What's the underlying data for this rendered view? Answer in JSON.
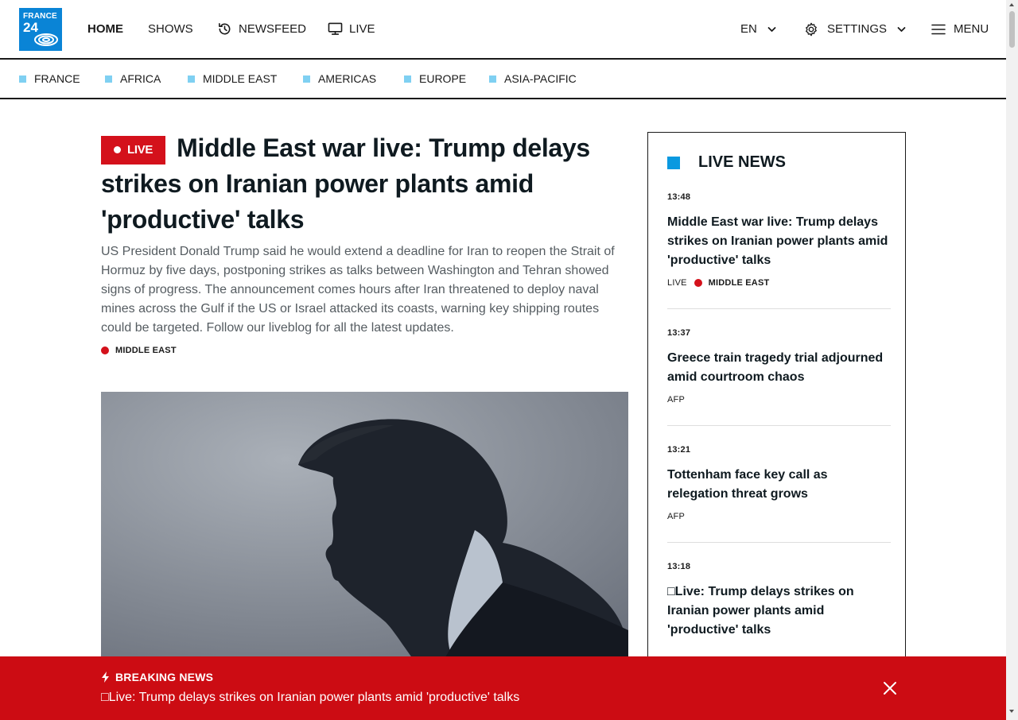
{
  "header": {
    "logo": {
      "line1": "FRANCE",
      "line2": "24"
    },
    "nav": [
      {
        "label": "HOME",
        "icon": null
      },
      {
        "label": "SHOWS",
        "icon": null
      },
      {
        "label": "NEWSFEED",
        "icon": "history-icon"
      },
      {
        "label": "LIVE",
        "icon": "tv-icon"
      }
    ],
    "language": {
      "label": "EN",
      "icon": "chevron-down-icon"
    },
    "settings": {
      "label": "SETTINGS",
      "icon": "gear-icon"
    },
    "menu": {
      "label": "MENU",
      "icon": "hamburger-icon"
    }
  },
  "regions": [
    "FRANCE",
    "AFRICA",
    "MIDDLE EAST",
    "AMERICAS",
    "EUROPE",
    "ASIA-PACIFIC"
  ],
  "article": {
    "live_badge": "LIVE",
    "headline": "Middle East war live: Trump delays strikes on Iranian power plants amid 'productive' talks",
    "lede": "US President Donald Trump said he would extend a deadline for Iran to reopen the Strait of Hormuz by five days, postponing strikes as talks between Washington and Tehran showed signs of progress. The announcement comes hours after Iran threatened to deploy naval mines across the Gulf if the US or Israel attacked its coasts, warning key shipping routes could be targeted. Follow our liveblog for all the latest updates.",
    "category": "MIDDLE EAST"
  },
  "live_news": {
    "title": "LIVE NEWS",
    "items": [
      {
        "time": "13:48",
        "headline": "Middle East war live: Trump delays strikes on Iranian power plants amid 'productive' talks",
        "meta_prefix": "LIVE",
        "meta": "MIDDLE EAST"
      },
      {
        "time": "13:37",
        "headline": "Greece train tragedy trial adjourned amid courtroom chaos",
        "meta": "AFP"
      },
      {
        "time": "13:21",
        "headline": "Tottenham face key call as relegation threat grows",
        "meta": "AFP"
      },
      {
        "time": "13:18",
        "headline": "□Live: Trump delays strikes on Iranian power plants amid 'productive' talks"
      }
    ]
  },
  "breaking": {
    "label": "BREAKING NEWS",
    "text": "□Live: Trump delays strikes on Iranian power plants amid 'productive' talks"
  },
  "colors": {
    "accent_red": "#d4111b",
    "brand_blue": "#0a84d6",
    "region_square": "#7fd0f2",
    "banner_red": "#cc0c13"
  }
}
